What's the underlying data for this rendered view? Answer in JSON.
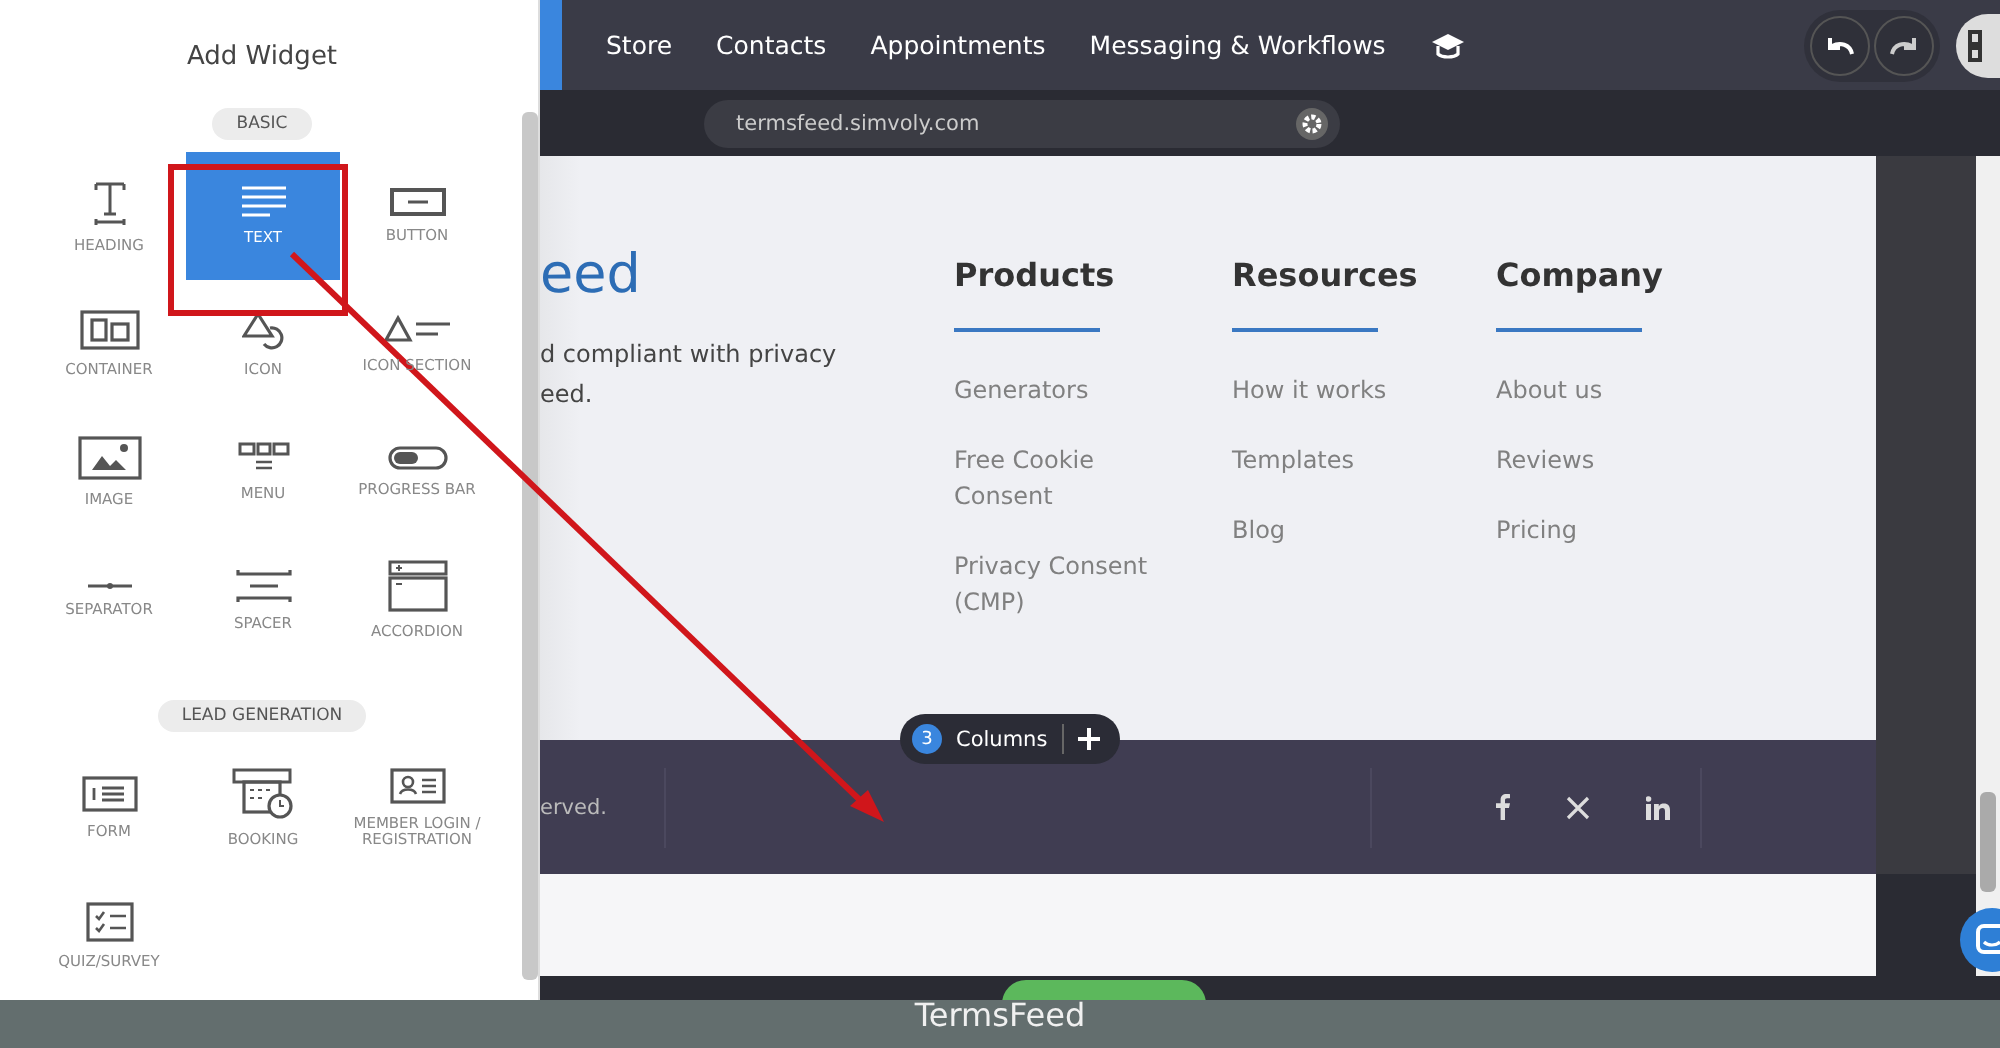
{
  "panel": {
    "title": "Add Widget",
    "sections": [
      {
        "label": "BASIC",
        "widgets": [
          {
            "label": "HEADING",
            "kind": "heading",
            "selected": false
          },
          {
            "label": "TEXT",
            "kind": "text",
            "selected": true
          },
          {
            "label": "BUTTON",
            "kind": "button",
            "selected": false
          },
          {
            "label": "CONTAINER",
            "kind": "container",
            "selected": false
          },
          {
            "label": "ICON",
            "kind": "icon",
            "selected": false
          },
          {
            "label": "ICON SECTION",
            "kind": "iconsection",
            "selected": false
          },
          {
            "label": "IMAGE",
            "kind": "image",
            "selected": false
          },
          {
            "label": "MENU",
            "kind": "menu",
            "selected": false
          },
          {
            "label": "PROGRESS BAR",
            "kind": "progress",
            "selected": false
          },
          {
            "label": "SEPARATOR",
            "kind": "separator",
            "selected": false
          },
          {
            "label": "SPACER",
            "kind": "spacer",
            "selected": false
          },
          {
            "label": "ACCORDION",
            "kind": "accordion",
            "selected": false
          }
        ]
      },
      {
        "label": "LEAD GENERATION",
        "widgets": [
          {
            "label": "FORM",
            "kind": "form",
            "selected": false
          },
          {
            "label": "BOOKING",
            "kind": "booking",
            "selected": false
          },
          {
            "label": "MEMBER LOGIN / REGISTRATION",
            "kind": "member",
            "selected": false
          },
          {
            "label": "QUIZ/SURVEY",
            "kind": "quiz",
            "selected": false
          }
        ]
      }
    ]
  },
  "nav": {
    "items": [
      "Store",
      "Contacts",
      "Appointments",
      "Messaging & Workflows"
    ]
  },
  "address": {
    "url": "termsfeed.simvoly.com"
  },
  "page": {
    "brand": "eed",
    "tagline": [
      "d compliant with privacy",
      "eed."
    ],
    "columns": [
      {
        "heading": "Products",
        "links": [
          "Generators",
          "Free Cookie Consent",
          "Privacy Consent (CMP)"
        ]
      },
      {
        "heading": "Resources",
        "links": [
          "How it works",
          "Templates",
          "Blog"
        ]
      },
      {
        "heading": "Company",
        "links": [
          "About us",
          "Reviews",
          "Pricing"
        ]
      }
    ],
    "copyright": "erved.",
    "columns_badge": {
      "count": "3",
      "label": "Columns"
    }
  },
  "caption": "TermsFeed"
}
